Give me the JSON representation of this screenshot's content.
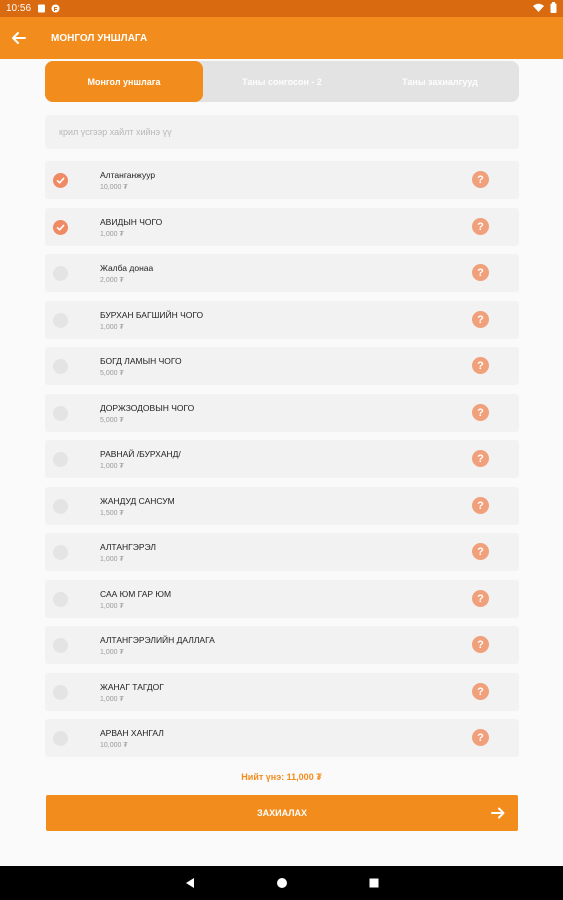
{
  "status_bar": {
    "time": "10:56"
  },
  "app_bar": {
    "title": "МОНГОЛ УНШЛАГА"
  },
  "tabs": [
    {
      "label": "Монгол уншлага"
    },
    {
      "label": "Таны сонгосон - 2"
    },
    {
      "label": "Таны захиалгууд"
    }
  ],
  "search": {
    "placeholder": "крил үсгээр хайлт хийнэ үү"
  },
  "items": [
    {
      "name": "Алтанганжуур",
      "price": "10,000 ₮",
      "checked": true
    },
    {
      "name": "АВИДЫН ЧОГО",
      "price": "1,000 ₮",
      "checked": true
    },
    {
      "name": "Жалба донаа",
      "price": "2,000 ₮",
      "checked": false
    },
    {
      "name": "БУРХАН БАГШИЙН ЧОГО",
      "price": "1,000 ₮",
      "checked": false
    },
    {
      "name": "БОГД ЛАМЫН ЧОГО",
      "price": "5,000 ₮",
      "checked": false
    },
    {
      "name": "ДОРЖЗОДОВЫН ЧОГО",
      "price": "5,000 ₮",
      "checked": false
    },
    {
      "name": "РАВНАЙ /БУРХАНД/",
      "price": "1,000 ₮",
      "checked": false
    },
    {
      "name": "ЖАНДУД САНСУМ",
      "price": "1,500 ₮",
      "checked": false
    },
    {
      "name": "АЛТАНГЭРЭЛ",
      "price": "1,000 ₮",
      "checked": false
    },
    {
      "name": "САА ЮМ ГАР ЮМ",
      "price": "1,000 ₮",
      "checked": false
    },
    {
      "name": "АЛТАНГЭРЭЛИЙН ДАЛЛАГА",
      "price": "1,000 ₮",
      "checked": false
    },
    {
      "name": "ЖАНАГ ТАГДОГ",
      "price": "1,000 ₮",
      "checked": false
    },
    {
      "name": "АРВАН ХАНГАЛ",
      "price": "10,000 ₮",
      "checked": false
    }
  ],
  "help_symbol": "?",
  "total": {
    "text": "Нийт үнэ: 11,000 ₮"
  },
  "order_button": {
    "label": "ЗАХИАЛАХ"
  },
  "colors": {
    "accent": "#f28c1c",
    "status_bar": "#d96a10",
    "check": "#ef8a64"
  }
}
